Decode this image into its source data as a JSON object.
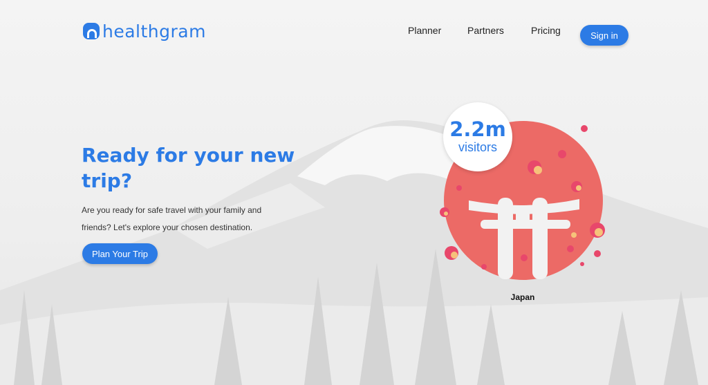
{
  "header": {
    "logo_text": "healthgram",
    "nav": [
      "Planner",
      "Partners",
      "Pricing"
    ],
    "signin_label": "Sign in"
  },
  "hero": {
    "title": "Ready for your new trip?",
    "description": "Are you ready for safe travel with your family and friends? Let's explore your chosen destination.",
    "cta_label": "Plan Your Trip"
  },
  "destination": {
    "stat_value": "2.2m",
    "stat_label": "visitors",
    "country": "Japan"
  },
  "colors": {
    "primary": "#2c7be5",
    "sun": "#ec6a66",
    "blossom": "#e8476b",
    "blossom_light": "#f6c27a"
  },
  "icons": {
    "logo": "h-logo-icon",
    "illustration": "torii-gate-icon"
  }
}
